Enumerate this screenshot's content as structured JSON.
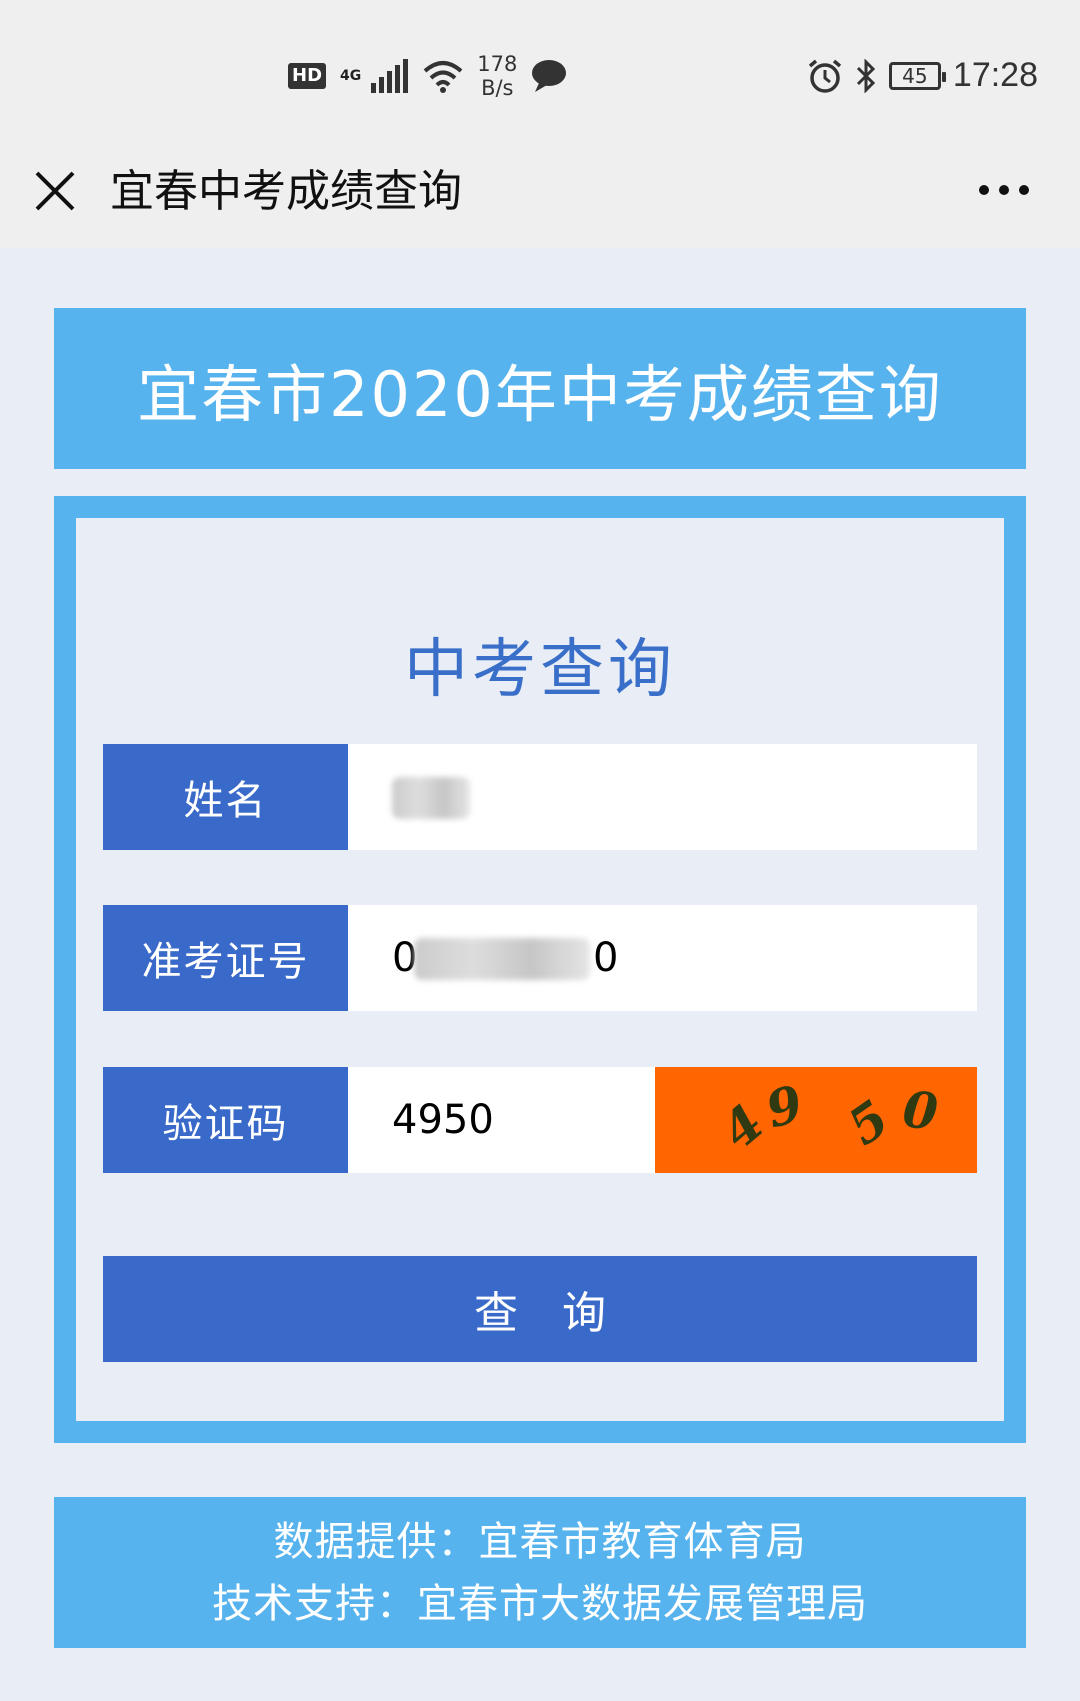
{
  "status_bar": {
    "hd": "HD",
    "network": "4G",
    "speed_value": "178",
    "speed_unit": "B/s",
    "battery": "45",
    "time": "17:28"
  },
  "nav": {
    "title": "宜春中考成绩查询"
  },
  "banner": {
    "title": "宜春市2020年中考成绩查询"
  },
  "form": {
    "heading": "中考查询",
    "name_label": "姓名",
    "exam_id_label": "准考证号",
    "exam_id_value": "0",
    "exam_id_value_tail": "0",
    "captcha_label": "验证码",
    "captcha_value": "4950",
    "captcha_chars": [
      "4",
      "9",
      "5",
      "0"
    ],
    "submit_label": "查询"
  },
  "footer": {
    "line1": "数据提供：宜春市教育体育局",
    "line2": "技术支持：宜春市大数据发展管理局"
  },
  "colors": {
    "banner": "#57b3ee",
    "label_bg": "#3a6ac9",
    "heading": "#3a6fc9",
    "captcha_bg": "#ff6500",
    "page_bg": "#e8edf6"
  }
}
